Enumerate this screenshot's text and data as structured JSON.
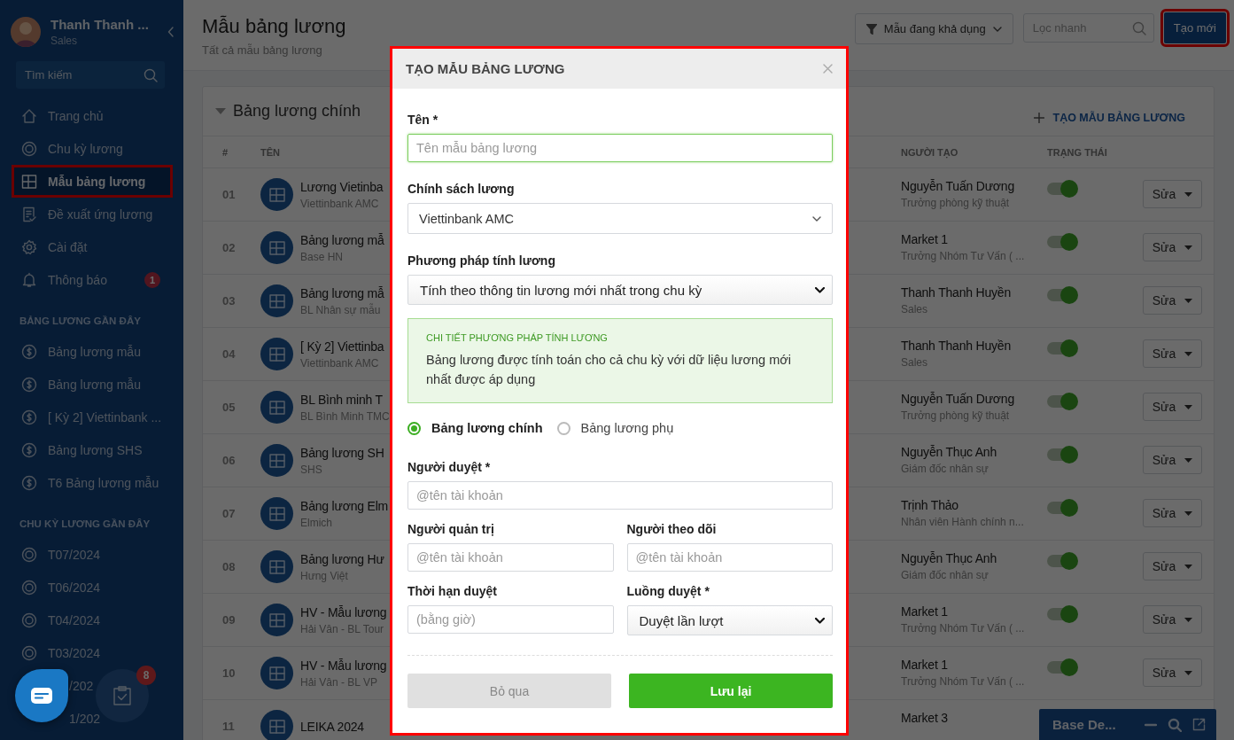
{
  "sidebar": {
    "user": {
      "name": "Thanh Thanh ...",
      "role": "Sales"
    },
    "search": {
      "placeholder": "Tìm kiếm"
    },
    "nav": [
      {
        "label": "Trang chủ",
        "selected": false,
        "highlighted": false
      },
      {
        "label": "Chu kỳ lương",
        "selected": false,
        "highlighted": false
      },
      {
        "label": "Mẫu bảng lương",
        "selected": true,
        "highlighted": true
      },
      {
        "label": "Đề xuất ứng lương",
        "selected": false,
        "highlighted": false
      },
      {
        "label": "Cài đặt",
        "selected": false,
        "highlighted": false
      },
      {
        "label": "Thông báo",
        "selected": false,
        "highlighted": false,
        "badge": "1"
      }
    ],
    "sections": [
      {
        "title": "BẢNG LƯƠNG GẦN ĐÂY",
        "items": [
          {
            "label": "Bảng lương mẫu",
            "kind": "link"
          },
          {
            "label": "Bảng lương mẫu",
            "kind": "link"
          },
          {
            "label": "[ Kỳ 2] Viettinbank ...",
            "kind": "link"
          },
          {
            "label": "Bảng lương SHS",
            "kind": "link"
          },
          {
            "label": "T6 Bảng lương mẫu",
            "kind": "link"
          }
        ]
      },
      {
        "title": "CHU KỲ LƯƠNG GẦN ĐÂY",
        "items": [
          {
            "label": "T07/2024",
            "kind": "link"
          },
          {
            "label": "T06/2024",
            "kind": "link"
          },
          {
            "label": "T04/2024",
            "kind": "link"
          },
          {
            "label": "T03/2024",
            "kind": "link"
          },
          {
            "label": "/202",
            "kind": "covered"
          },
          {
            "label": "1/202",
            "kind": "covered"
          }
        ]
      }
    ]
  },
  "header": {
    "title": "Mẫu bảng lương",
    "subtitle": "Tất cả mẫu bảng lương",
    "filter": "Mẫu đang khả dụng",
    "search": {
      "placeholder": "Lọc nhanh"
    },
    "create_button": {
      "label": "Tạo mới",
      "highlighted": true
    }
  },
  "table": {
    "title": "Bảng lương chính",
    "expanded": true,
    "add_link": "TẠO MẪU BẢNG LƯƠNG",
    "columns": [
      "#",
      "TÊN",
      "NGƯỜI TẠO",
      "TRẠNG THÁI"
    ],
    "rows": [
      {
        "index": "01",
        "name": "Lương Vietinba",
        "policy": "Viettinbank AMC",
        "creator": "Nguyễn Tuấn Dương",
        "creator_role": "Trưởng phòng kỹ thuật",
        "on": true,
        "action": "Sửa"
      },
      {
        "index": "02",
        "name": "Bảng lương mẫ",
        "policy": "Base HN",
        "creator": "Market 1",
        "creator_role": "Trưởng Nhóm Tư Vấn ( ...",
        "on": true,
        "action": "Sửa"
      },
      {
        "index": "03",
        "name": "Bảng lương mẫ",
        "policy": "BL Nhân sự mẫu",
        "creator": "Thanh Thanh Huyền",
        "creator_role": "Sales",
        "on": true,
        "action": "Sửa"
      },
      {
        "index": "04",
        "name": "[ Kỳ 2] Viettinba",
        "policy": "Viettinbank AMC",
        "creator": "Thanh Thanh Huyền",
        "creator_role": "Sales",
        "on": true,
        "action": "Sửa"
      },
      {
        "index": "05",
        "name": "BL Bình minh T",
        "policy": "BL Bình Minh TMC",
        "creator": "Nguyễn Tuấn Dương",
        "creator_role": "Trưởng phòng kỹ thuật",
        "on": true,
        "action": "Sửa"
      },
      {
        "index": "06",
        "name": "Bảng lương SH",
        "policy": "SHS",
        "creator": "Nguyễn Thục Anh",
        "creator_role": "Giám đốc nhân sự",
        "on": true,
        "action": "Sửa"
      },
      {
        "index": "07",
        "name": "Bảng lương Elm",
        "policy": "Elmich",
        "creator": "Trịnh Thảo",
        "creator_role": "Nhân viên Hành chính n...",
        "on": true,
        "action": "Sửa"
      },
      {
        "index": "08",
        "name": "Bảng lương Hư",
        "policy": "Hưng Việt",
        "creator": "Nguyễn Thục Anh",
        "creator_role": "Giám đốc nhân sự",
        "on": true,
        "action": "Sửa"
      },
      {
        "index": "09",
        "name": "HV - Mẫu lương",
        "policy": "Hải Vân - BL Tour",
        "creator": "Market 1",
        "creator_role": "Trưởng Nhóm Tư Vấn ( ...",
        "on": true,
        "action": "Sửa"
      },
      {
        "index": "10",
        "name": "HV - Mẫu lương",
        "policy": "Hải Vân - BL VP",
        "creator": "Market 1",
        "creator_role": "Trưởng Nhóm Tư Vấn ( ...",
        "on": true,
        "action": "Sửa"
      },
      {
        "index": "11",
        "name": "LEIKA 2024",
        "creator": "Market 3"
      }
    ]
  },
  "modal": {
    "title": "TẠO MẪU BẢNG LƯƠNG",
    "highlighted": true,
    "name_label": "Tên *",
    "name_placeholder": "Tên mẫu bảng lương",
    "policy_label": "Chính sách lương",
    "policy_value": "Viettinbank AMC",
    "method_label": "Phương pháp tính lương",
    "method_value": "Tính theo thông tin lương mới nhất trong chu kỳ",
    "detail_title": "CHI TIẾT PHƯƠNG PHÁP TÍNH LƯƠNG",
    "detail_text": "Bảng lương được tính toán cho cả chu kỳ với dữ liệu lương mới nhất được áp dụng",
    "types": [
      {
        "label": "Bảng lương chính",
        "selected": true
      },
      {
        "label": "Bảng lương phụ",
        "selected": false
      }
    ],
    "approver_label": "Người duyệt *",
    "approver_placeholder": "@tên tài khoản",
    "admin_label": "Người quản trị",
    "admin_placeholder": "@tên tài khoản",
    "follower_label": "Người theo dõi",
    "follower_placeholder": "@tên tài khoản",
    "deadline_label": "Thời hạn duyệt",
    "deadline_placeholder": "(bằng giờ)",
    "flow_label": "Luồng duyệt *",
    "flow_value": "Duyệt lần lượt",
    "cancel": "Bỏ qua",
    "save": "Lưu lại"
  },
  "widgets": {
    "tasks_badge": "8",
    "chat_window": "Base De..."
  }
}
